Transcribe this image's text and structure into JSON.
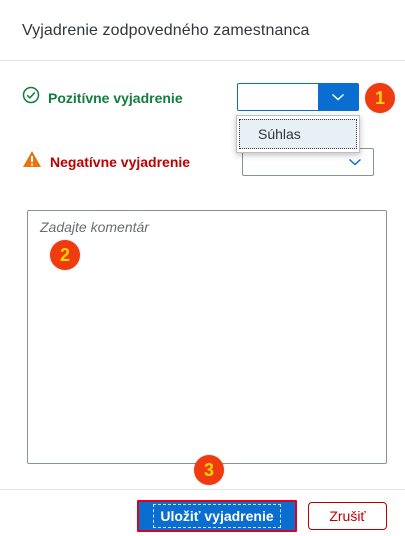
{
  "dialog": {
    "title": "Vyjadrenie zodpovedného zamestnanca"
  },
  "positive": {
    "label": "Pozitívne vyjadrenie",
    "icon": "check-circle-icon",
    "color": "#107e3e",
    "selected": ""
  },
  "negative": {
    "label": "Negatívne vyjadrenie",
    "icon": "warning-icon",
    "color": "#bb0000",
    "selected": ""
  },
  "dropdown": {
    "options": [
      "Súhlas"
    ]
  },
  "comment": {
    "placeholder": "Zadajte komentár",
    "value": ""
  },
  "footer": {
    "save_label": "Uložiť vyjadrenie",
    "cancel_label": "Zrušiť"
  },
  "badges": [
    "1",
    "2",
    "3"
  ],
  "colors": {
    "accent": "#0a6ed1",
    "badge_bg": "#f03a10",
    "badge_fg": "#ffd400",
    "highlight": "#e0001b"
  }
}
